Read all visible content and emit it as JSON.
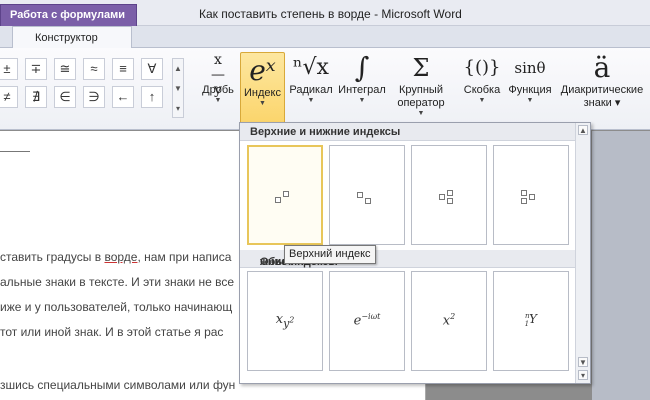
{
  "window": {
    "contextual_tab": "Работа с формулами",
    "title": "Как поставить степень в ворде  -  Microsoft Word"
  },
  "ribbon_tabs": {
    "constructor": "Конструктор"
  },
  "symbols": [
    "±",
    "∓",
    "≅",
    "≈",
    "≡",
    "∀",
    "≠",
    "∄",
    "∈",
    "∋",
    "←",
    "↑"
  ],
  "ribbon_buttons": {
    "fraction": {
      "label": "Дробь",
      "glyph": "x/y"
    },
    "index": {
      "label": "Индекс",
      "glyph": "eˣ"
    },
    "radical": {
      "label": "Радикал",
      "glyph": "ⁿ√x"
    },
    "integral": {
      "label": "Интеграл",
      "glyph": "∫"
    },
    "large_operator": {
      "label": "Крупный",
      "label2": "оператор",
      "glyph": "Σ"
    },
    "bracket": {
      "label": "Скобка",
      "glyph": "{()}"
    },
    "function": {
      "label": "Функция",
      "glyph": "sinθ"
    },
    "accent": {
      "label": "Диакритические",
      "label2": "знаки",
      "glyph": "ä"
    }
  },
  "gallery": {
    "section1_title": "Верхние и нижние индексы",
    "section2_title": "Обычные верхние и нижние индексы",
    "section2_visible": "Обыч",
    "section2_visible_tail": "жние индексы",
    "common_items": [
      "x",
      "y",
      "2",
      "e",
      "−iωt",
      "x",
      "2",
      "n",
      "1",
      "Y"
    ],
    "tooltip": "Верхний индекс"
  },
  "document": {
    "lines": [
      {
        "pre": "ставить градусы в ",
        "link": "ворде",
        "post": ", нам при написа"
      },
      {
        "text": "альные знаки в тексте. И эти знаки не все"
      },
      {
        "text": "иже и у пользователей, только начинающ"
      },
      {
        "text": "тот или иной знак. И в этой статье я рас"
      },
      {
        "text": "зшись специальными символами или фун"
      }
    ]
  },
  "colors": {
    "contextual_tab": "#7b5fa8",
    "active_button": "#fbd56c",
    "selected_item_border": "#e8c65a"
  }
}
